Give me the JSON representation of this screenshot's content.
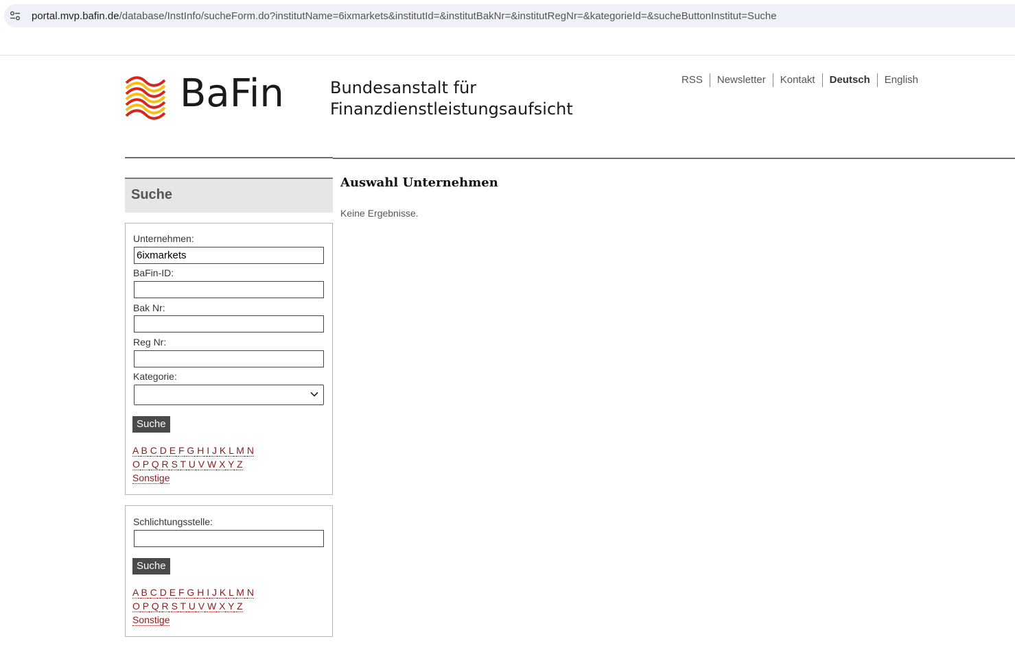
{
  "browser": {
    "url_host": "portal.mvp.bafin.de",
    "url_path": "/database/InstInfo/sucheForm.do?institutName=6ixmarkets&institutId=&institutBakNr=&institutRegNr=&kategorieId=&sucheButtonInstitut=Suche"
  },
  "header": {
    "logo_text": "BaFin",
    "org_line1": "Bundesanstalt für",
    "org_line2": "Finanzdienstleistungsaufsicht",
    "service_nav": [
      "RSS",
      "Newsletter",
      "Kontakt",
      "Deutsch",
      "English"
    ],
    "active_language": "Deutsch"
  },
  "sidebar": {
    "title": "Suche",
    "company_form": {
      "company_label": "Unternehmen:",
      "company_value": "6ixmarkets",
      "bafin_id_label": "BaFin-ID:",
      "bafin_id_value": "",
      "bak_nr_label": "Bak Nr:",
      "bak_nr_value": "",
      "reg_nr_label": "Reg Nr:",
      "reg_nr_value": "",
      "category_label": "Kategorie:",
      "category_value": "",
      "submit_label": "Suche",
      "letters_row1": [
        "A",
        "B",
        "C",
        "D",
        "E",
        "F",
        "G",
        "H",
        "I",
        "J",
        "K",
        "L",
        "M",
        "N"
      ],
      "letters_row2": [
        "O",
        "P",
        "Q",
        "R",
        "S",
        "T",
        "U",
        "V",
        "W",
        "X",
        "Y",
        "Z"
      ],
      "other_label": "Sonstige"
    },
    "arbitration_form": {
      "label": "Schlichtungsstelle:",
      "value": "",
      "submit_label": "Suche",
      "letters_row1": [
        "A",
        "B",
        "C",
        "D",
        "E",
        "F",
        "G",
        "H",
        "I",
        "J",
        "K",
        "L",
        "M",
        "N"
      ],
      "letters_row2": [
        "O",
        "P",
        "Q",
        "R",
        "S",
        "T",
        "U",
        "V",
        "W",
        "X",
        "Y",
        "Z"
      ],
      "other_label": "Sonstige"
    }
  },
  "main": {
    "title": "Auswahl Unternehmen",
    "result_text": "Keine Ergebnisse."
  },
  "colors": {
    "link": "#8b1c1c",
    "button": "#4a4a4a",
    "logo_red": "#d0281e",
    "logo_yellow": "#f2c01c"
  },
  "icons": [
    "site-info-icon",
    "bafin-waves-logo",
    "chevron-down-icon"
  ]
}
